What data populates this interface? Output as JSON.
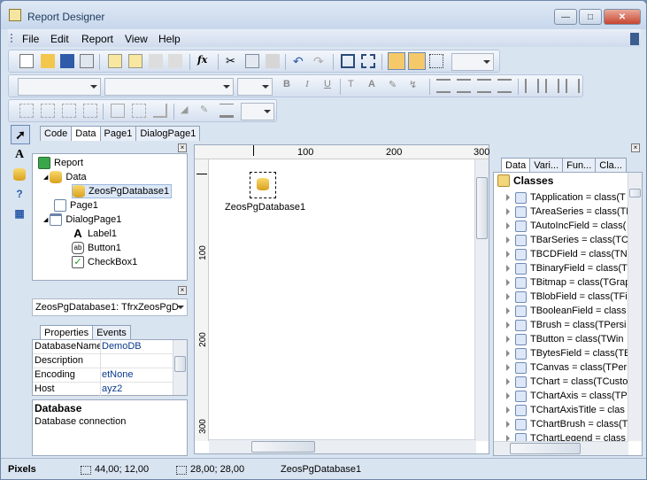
{
  "window": {
    "title": "Report Designer",
    "controls": [
      "minimize",
      "maximize",
      "close"
    ]
  },
  "menu": [
    "File",
    "Edit",
    "Report",
    "View",
    "Help"
  ],
  "toolbar": {
    "zoom_value": "",
    "font_name": "",
    "font_style": "",
    "font_size": "",
    "frame_width": ""
  },
  "tabs": [
    {
      "label": "Code"
    },
    {
      "label": "Data"
    },
    {
      "label": "Page1"
    },
    {
      "label": "DialogPage1"
    }
  ],
  "tree": {
    "items": [
      {
        "label": "Report",
        "icon": "report-icon",
        "level": 0
      },
      {
        "label": "Data",
        "icon": "database-icon",
        "level": 1
      },
      {
        "label": "ZeosPgDatabase1",
        "icon": "database-icon",
        "level": 2,
        "selected": true
      },
      {
        "label": "Page1",
        "icon": "page-icon",
        "level": 1
      },
      {
        "label": "DialogPage1",
        "icon": "dialog-page-icon",
        "level": 1
      },
      {
        "label": "Label1",
        "icon": "label-icon",
        "level": 2
      },
      {
        "label": "Button1",
        "icon": "button-icon",
        "level": 2
      },
      {
        "label": "CheckBox1",
        "icon": "checkbox-icon",
        "level": 2
      }
    ]
  },
  "inspector": {
    "object": "ZeosPgDatabase1: TfrxZeosPgD",
    "tabs": [
      "Properties",
      "Events"
    ],
    "rows": [
      {
        "key": "DatabaseName",
        "value": "DemoDB"
      },
      {
        "key": "Description",
        "value": ""
      },
      {
        "key": "Encoding",
        "value": "etNone"
      },
      {
        "key": "Host",
        "value": "ayz2"
      }
    ],
    "desc_title": "Database",
    "desc_text": "Database connection"
  },
  "canvas": {
    "component_label": "ZeosPgDatabase1",
    "ruler_h": [
      "100",
      "200",
      "300"
    ],
    "ruler_v": [
      "100",
      "200",
      "300"
    ]
  },
  "right_panel": {
    "tabs": [
      "Data",
      "Vari...",
      "Fun...",
      "Cla..."
    ],
    "root": "Classes",
    "items": [
      "TApplication = class(T",
      "TAreaSeries = class(TF",
      "TAutoIncField = class(",
      "TBarSeries = class(TC",
      "TBCDField = class(TNu",
      "TBinaryField = class(T",
      "TBitmap = class(TGrap",
      "TBlobField = class(TFi",
      "TBooleanField = class",
      "TBrush = class(TPersi",
      "TButton = class(TWin",
      "TBytesField = class(TB",
      "TCanvas = class(TPer",
      "TChart = class(TCusto",
      "TChartAxis = class(TP",
      "TChartAxisTitle = clas",
      "TChartBrush = class(T",
      "TChartLegend = class"
    ]
  },
  "status": {
    "units": "Pixels",
    "position": "44,00; 12,00",
    "size": "28,00; 28,00",
    "selected": "ZeosPgDatabase1"
  }
}
